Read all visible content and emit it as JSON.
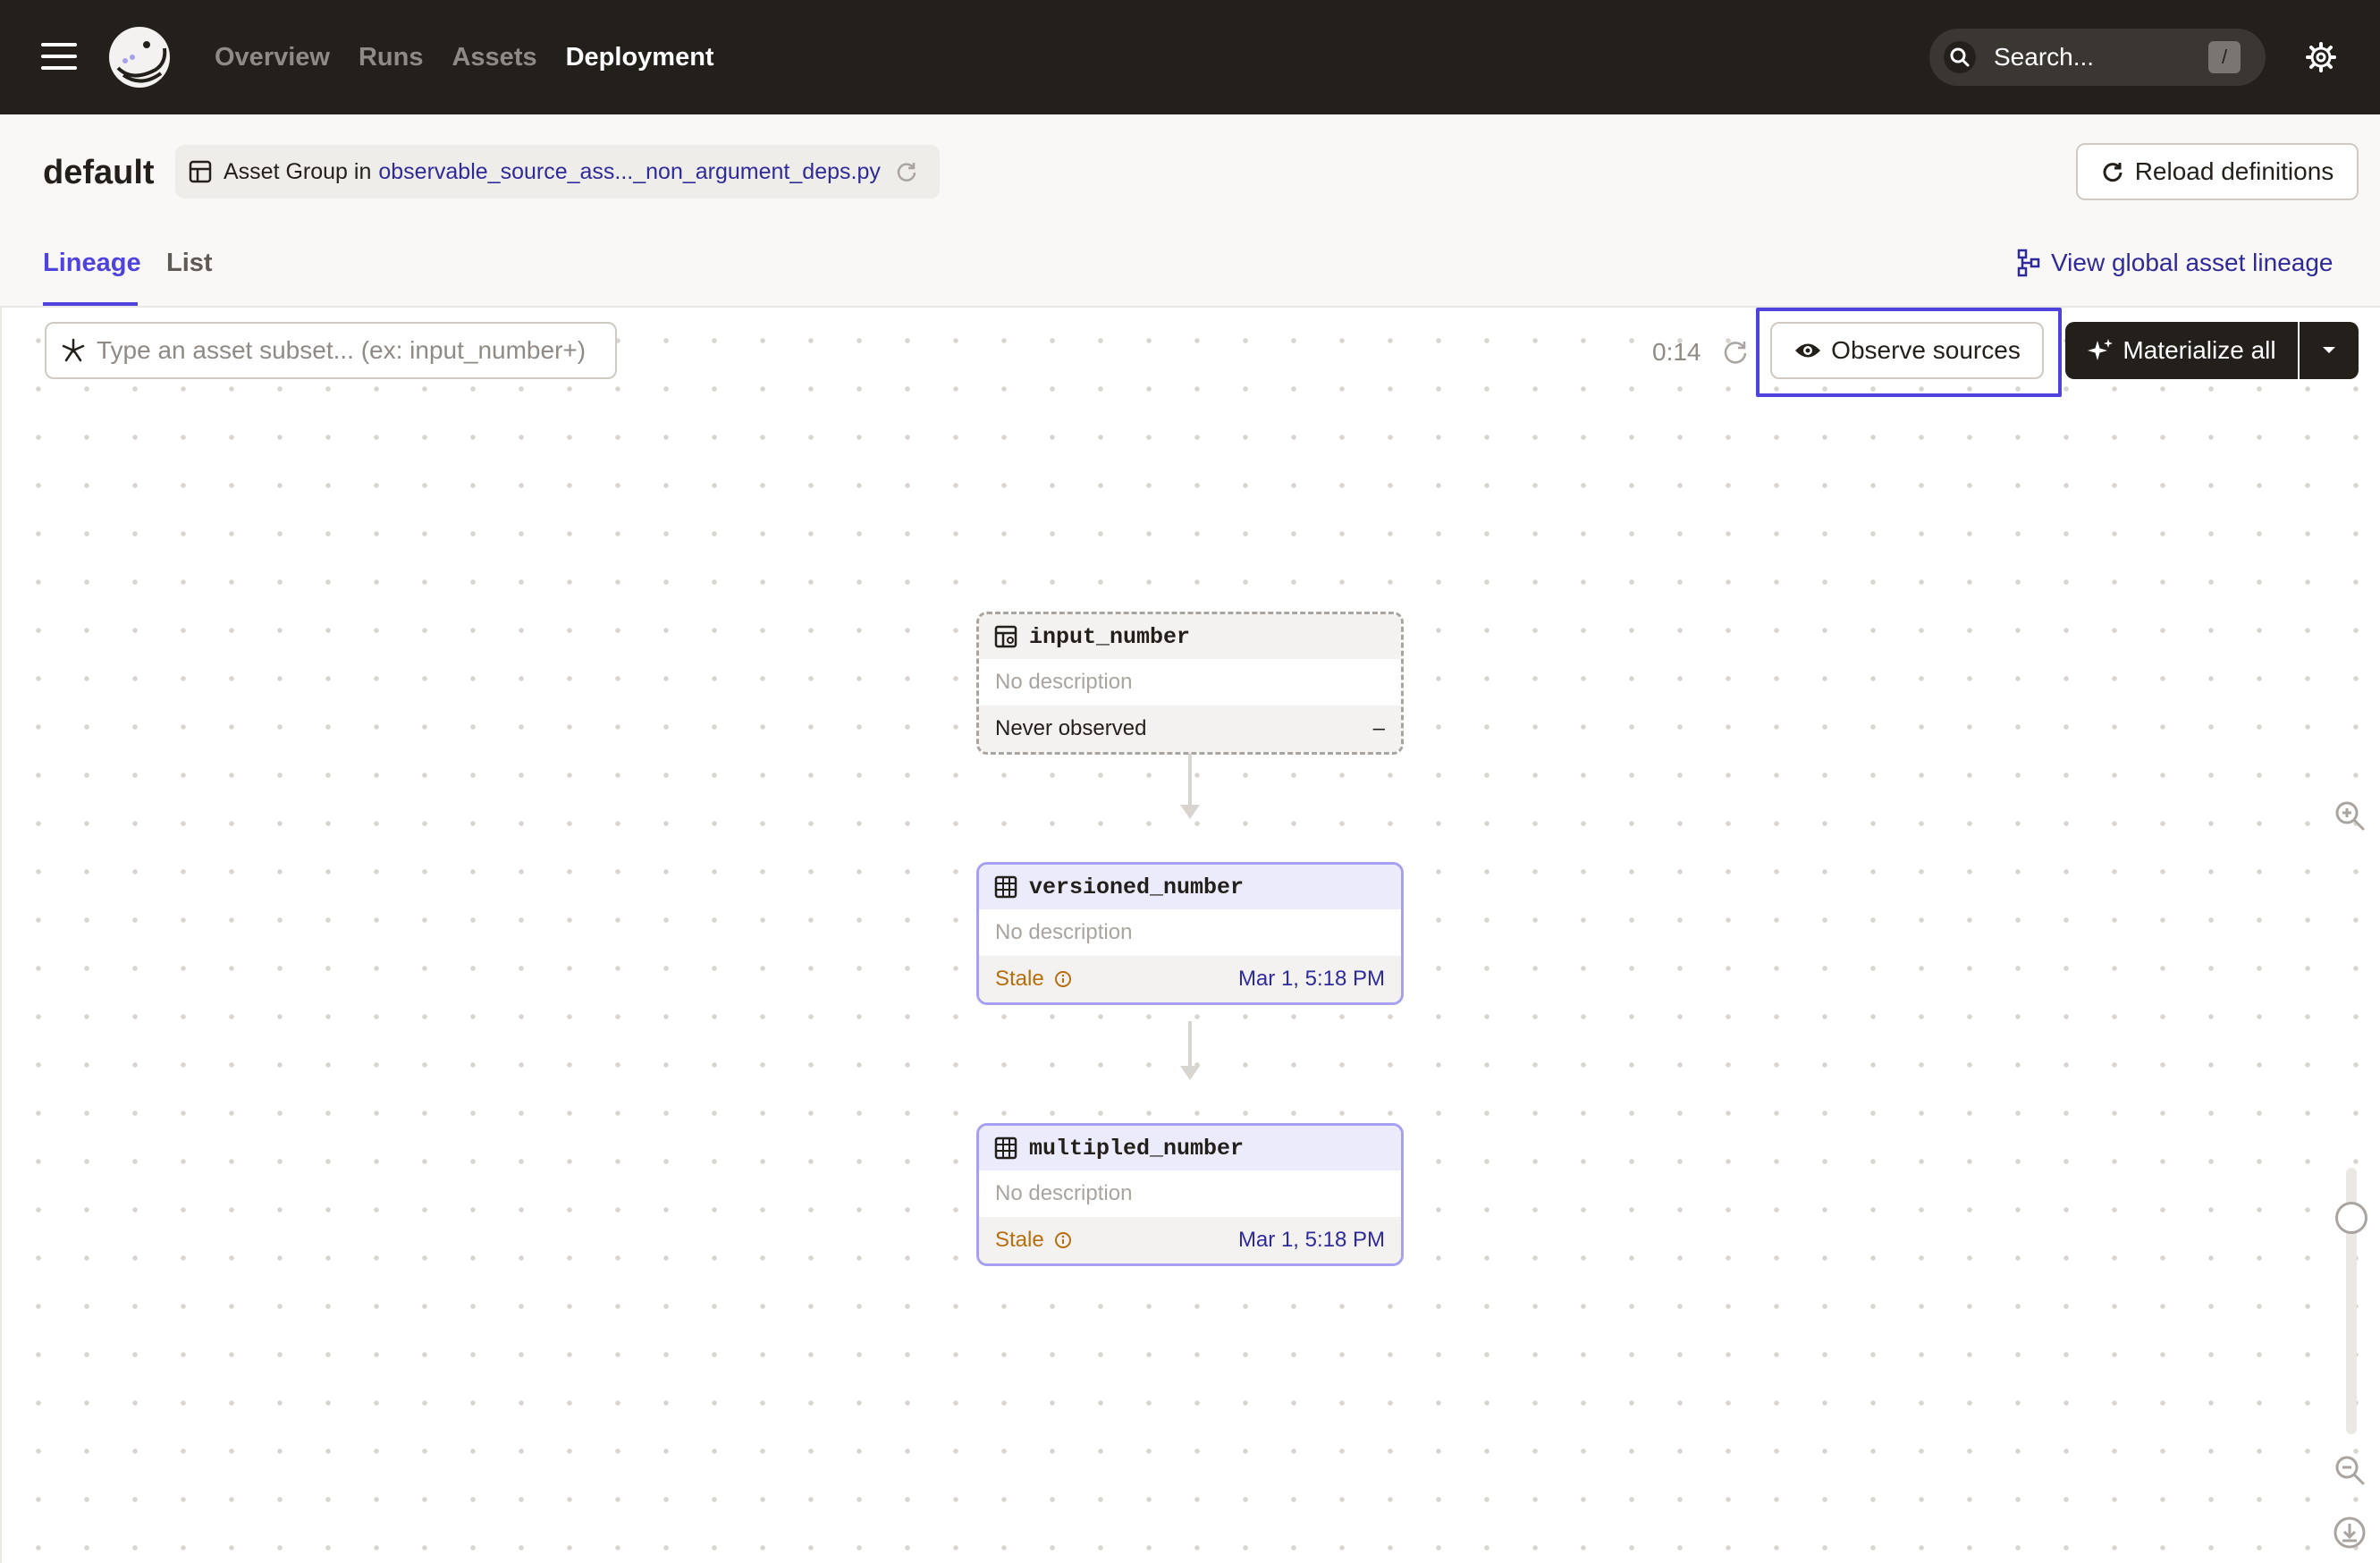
{
  "topbar": {
    "nav": [
      "Overview",
      "Runs",
      "Assets",
      "Deployment"
    ],
    "active_nav": "Deployment",
    "search_placeholder": "Search...",
    "search_shortcut": "/"
  },
  "header": {
    "title": "default",
    "group_prefix": "Asset Group in",
    "group_link": "observable_source_ass..._non_argument_deps.py",
    "reload_label": "Reload definitions",
    "tabs": [
      "Lineage",
      "List"
    ],
    "active_tab": "Lineage",
    "global_lineage_label": "View global asset lineage"
  },
  "toolbar": {
    "filter_placeholder": "Type an asset subset... (ex: input_number+)",
    "timer": "0:14",
    "observe_label": "Observe sources",
    "materialize_label": "Materialize all"
  },
  "nodes": [
    {
      "name": "input_number",
      "description": "No description",
      "status": "Never observed",
      "value": "–",
      "kind": "source"
    },
    {
      "name": "versioned_number",
      "description": "No description",
      "status": "Stale",
      "value": "Mar 1, 5:18 PM",
      "kind": "asset"
    },
    {
      "name": "multipled_number",
      "description": "No description",
      "status": "Stale",
      "value": "Mar 1, 5:18 PM",
      "kind": "asset"
    }
  ],
  "colors": {
    "accent": "#4f43dd",
    "topbar": "#231f1b",
    "stale": "#b86e0e",
    "link": "#2f2a9a"
  },
  "icons": {
    "menu": "hamburger-icon",
    "logo": "dagster-logo-icon",
    "search": "search-icon",
    "settings": "gear-icon",
    "asset": "table-icon",
    "source": "source-table-icon",
    "observe": "eye-icon",
    "materialize": "sparkle-icon",
    "reload": "refresh-icon"
  }
}
